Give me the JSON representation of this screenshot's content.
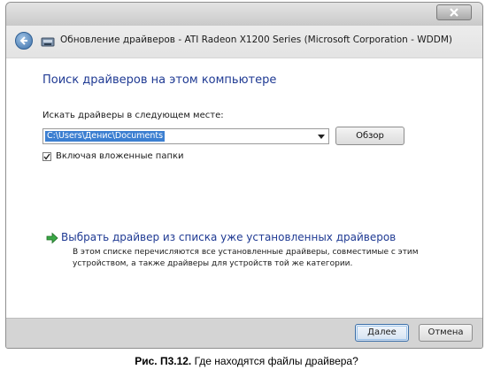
{
  "window": {
    "title": "Обновление драйверов - ATI Radeon X1200 Series (Microsoft Corporation - WDDM)",
    "close_icon": "close-icon",
    "back_icon": "back-arrow-icon",
    "wizard_icon": "hardware-wizard-icon"
  },
  "main": {
    "heading": "Поиск драйверов на этом компьютере",
    "search_label": "Искать драйверы в следующем месте:",
    "path_value": "C:\\Users\\Денис\\Documents",
    "browse_label": "Обзор",
    "include_subfolders_label": "Включая вложенные папки",
    "include_subfolders_checked": true,
    "pick_link": "Выбрать драйвер из списка уже установленных драйверов",
    "pick_description": "В этом списке перечисляются все установленные драйверы, совместимые с этим устройством, а также драйверы для устройств той же категории."
  },
  "footer": {
    "next_label": "Далее",
    "cancel_label": "Отмена"
  },
  "caption": {
    "figure_label": "Рис. П3.12.",
    "text": " Где находятся файлы драйвера?"
  },
  "colors": {
    "heading": "#1f3a93",
    "selection": "#3c7fd1",
    "footer": "#d4d4d4"
  }
}
